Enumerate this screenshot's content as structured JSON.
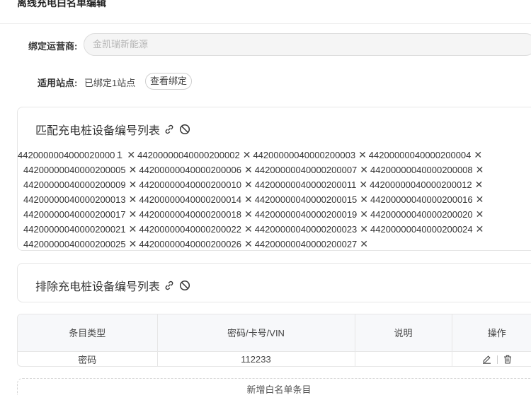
{
  "page": {
    "title": "离线充电白名单编辑"
  },
  "form": {
    "operator_label": "绑定运营商:",
    "operator_placeholder": "金凯瑞新能源",
    "station_label": "适用站点:",
    "station_value": "已绑定1站点",
    "view_binding_label": "查看绑定"
  },
  "match_section": {
    "title": "匹配充电桩设备编号列表",
    "icons": [
      "link-icon",
      "ban-icon"
    ],
    "remove_glyph": "✕",
    "rows": [
      [
        "4420000004000020000１",
        "44200000040000200002",
        "44200000040000200003",
        "44200000040000200004"
      ],
      [
        "44200000040000200005",
        "44200000040000200006",
        "44200000040000200007",
        "44200000040000200008"
      ],
      [
        "44200000040000200009",
        "44200000040000200010",
        "44200000040000200011",
        "44200000040000200012"
      ],
      [
        "44200000040000200013",
        "44200000040000200014",
        "44200000040000200015",
        "44200000040000200016"
      ],
      [
        "44200000040000200017",
        "44200000040000200018",
        "44200000040000200019",
        "44200000040000200020"
      ],
      [
        "44200000040000200021",
        "44200000040000200022",
        "44200000040000200023",
        "44200000040000200024"
      ],
      [
        "44200000040000200025",
        "44200000040000200026",
        "44200000040000200027"
      ]
    ]
  },
  "exclude_section": {
    "title": "排除充电桩设备编号列表",
    "icons": [
      "link-icon",
      "ban-icon"
    ]
  },
  "whitelist_table": {
    "headers": [
      "条目类型",
      "密码/卡号/VIN",
      "说明",
      "操作"
    ],
    "rows": [
      {
        "type": "密码",
        "code": "112233",
        "note": ""
      }
    ]
  },
  "add_entry_label": "新增白名单条目"
}
